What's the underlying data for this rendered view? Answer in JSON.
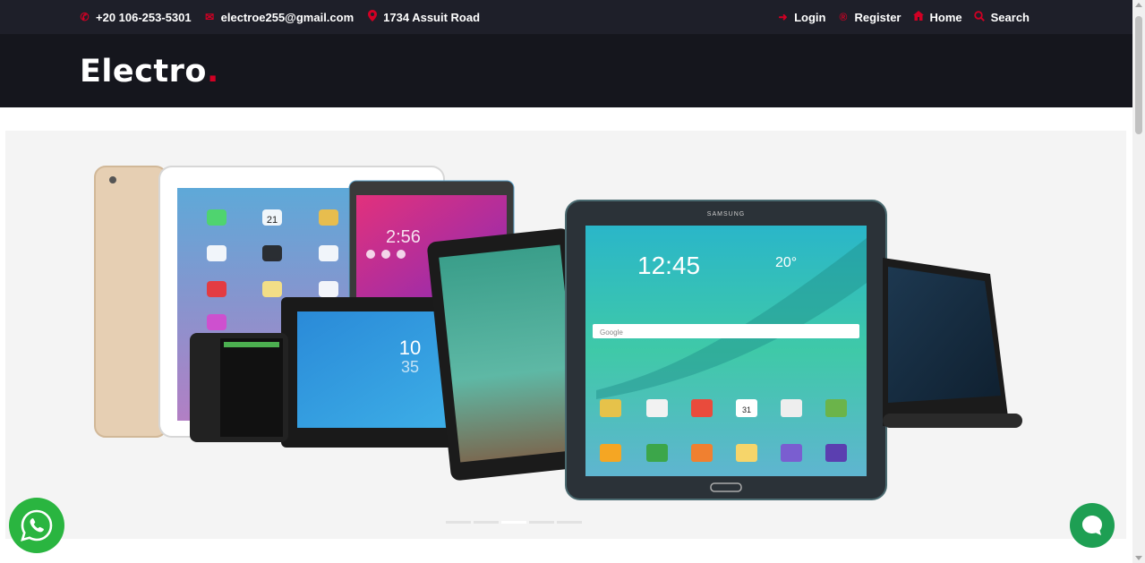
{
  "top_header": {
    "phone": "+20 106-253-5301",
    "email": "electroe255@gmail.com",
    "address": "1734 Assuit Road",
    "links": [
      "Login",
      "Register",
      "Home",
      "Search"
    ]
  },
  "brand": {
    "name": "Electro",
    "dot": ".",
    "accent": "#d10024"
  },
  "colors": {
    "topbar": "#1e1f29",
    "header": "#15161d",
    "whatsapp": "#2ab540",
    "chat": "#1e9f53"
  },
  "tablets": {
    "samsung_brand": "SAMSUNG",
    "samsung_time": "12:45",
    "samsung_temp": "20°",
    "samsung_search": "Google",
    "sony_time": "10",
    "sony_time2": "35",
    "ipad_date": "21",
    "calendar": "31",
    "asus_time": "2:56"
  },
  "slider": {
    "dots": 5,
    "active_index": 2
  },
  "icons": [
    "phone-icon",
    "envelope-icon",
    "map-marker-icon",
    "sign-in-icon",
    "registered-icon",
    "home-icon",
    "search-icon",
    "whatsapp-icon",
    "chat-icon"
  ]
}
